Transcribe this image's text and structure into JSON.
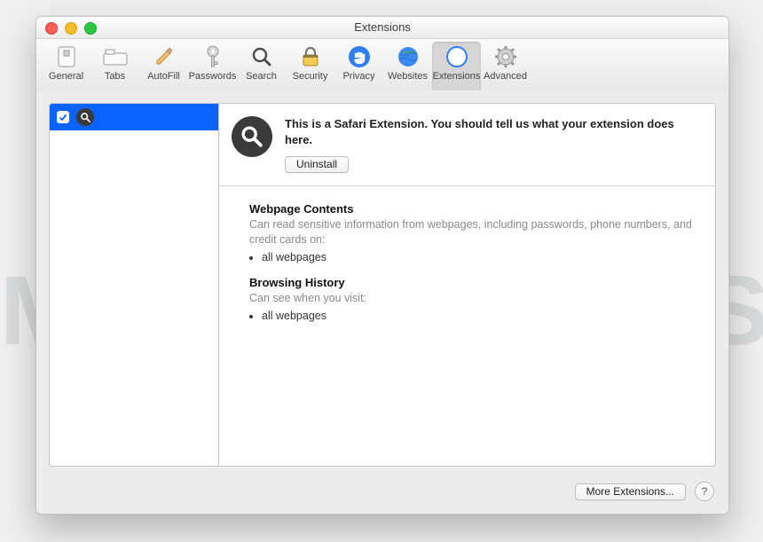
{
  "window": {
    "title": "Extensions"
  },
  "toolbar": {
    "items": [
      {
        "label": "General"
      },
      {
        "label": "Tabs"
      },
      {
        "label": "AutoFill"
      },
      {
        "label": "Passwords"
      },
      {
        "label": "Search"
      },
      {
        "label": "Security"
      },
      {
        "label": "Privacy"
      },
      {
        "label": "Websites"
      },
      {
        "label": "Extensions"
      },
      {
        "label": "Advanced"
      }
    ],
    "selected_index": 8
  },
  "sidebar": {
    "items": [
      {
        "checked": true,
        "icon": "magnifier-icon"
      }
    ]
  },
  "extension": {
    "description": "This is a Safari Extension. You should tell us what your extension does here.",
    "uninstall_label": "Uninstall"
  },
  "permissions": {
    "section1_title": "Webpage Contents",
    "section1_sub": "Can read sensitive information from webpages, including passwords, phone numbers, and credit cards on:",
    "section1_item": "all webpages",
    "section2_title": "Browsing History",
    "section2_sub": "Can see when you visit:",
    "section2_item": "all webpages"
  },
  "footer": {
    "more_label": "More Extensions...",
    "help_label": "?"
  },
  "watermark": "MALWARETIPS"
}
